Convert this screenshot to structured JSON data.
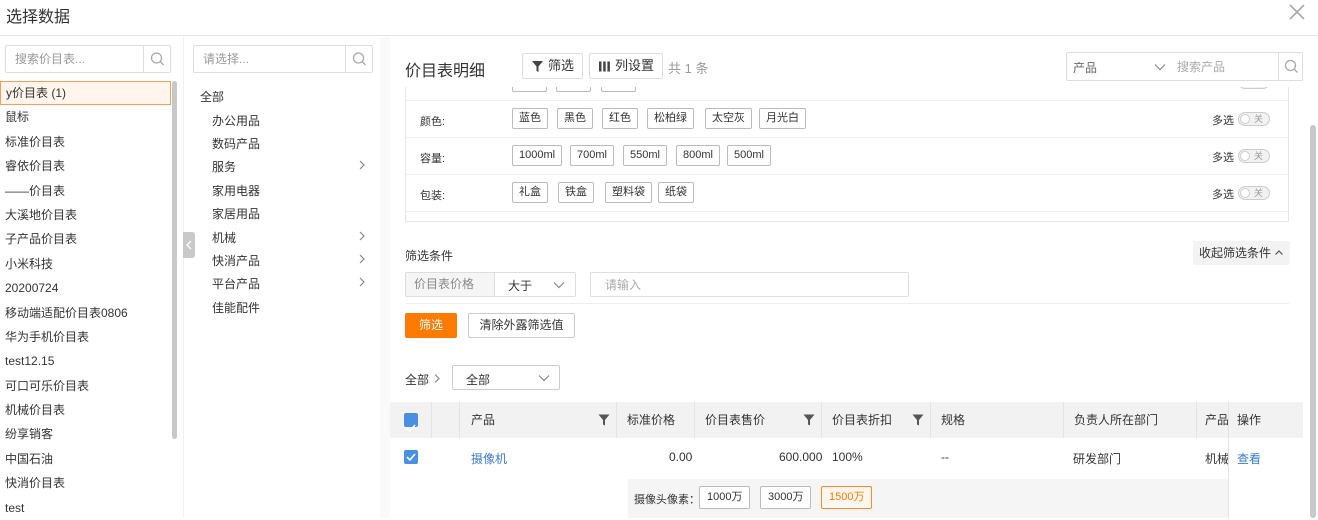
{
  "dialog": {
    "title": "选择数据"
  },
  "price_lists": {
    "search_placeholder": "搜索价目表...",
    "items": [
      "y价目表 (1)",
      "鼠标",
      "标准价目表",
      "睿依价目表",
      "——价目表",
      "大溪地价目表",
      "子产品价目表",
      "小米科技",
      "20200724",
      "移动端适配价目表0806",
      "华为手机价目表",
      "test12.15",
      "可口可乐价目表",
      "机械价目表",
      "纷享销客",
      "中国石油",
      "快消价目表",
      "test"
    ],
    "active_index": 0
  },
  "categories": {
    "search_placeholder": "请选择...",
    "all_label": "全部",
    "items": [
      {
        "label": "办公用品",
        "has_children": false
      },
      {
        "label": "数码产品",
        "has_children": false
      },
      {
        "label": "服务",
        "has_children": true
      },
      {
        "label": "家用电器",
        "has_children": false
      },
      {
        "label": "家居用品",
        "has_children": false
      },
      {
        "label": "机械",
        "has_children": true
      },
      {
        "label": "快消产品",
        "has_children": true
      },
      {
        "label": "平台产品",
        "has_children": true
      },
      {
        "label": "佳能配件",
        "has_children": false
      }
    ]
  },
  "main": {
    "title": "价目表明细",
    "filter_button": "筛选",
    "columns_button": "列设置",
    "count_text": "共 1 条",
    "product_select": "产品",
    "product_search_placeholder": "搜索产品"
  },
  "attributes": [
    {
      "label": "颜色:",
      "options": [
        "蓝色",
        "黑色",
        "红色",
        "松柏绿",
        "太空灰",
        "月光白"
      ],
      "multi_label": "多选",
      "toggle_label": "关"
    },
    {
      "label": "容量:",
      "options": [
        "1000ml",
        "700ml",
        "550ml",
        "800ml",
        "500ml"
      ],
      "multi_label": "多选",
      "toggle_label": "关"
    },
    {
      "label": "包装:",
      "options": [
        "礼盒",
        "铁盒",
        "塑料袋",
        "纸袋"
      ],
      "multi_label": "多选",
      "toggle_label": "关"
    }
  ],
  "filter": {
    "title": "筛选条件",
    "collapse_label": "收起筛选条件",
    "field": "价目表价格",
    "operator": "大于",
    "value_placeholder": "请输入",
    "apply_label": "筛选",
    "clear_label": "清除外露筛选值"
  },
  "breadcrumb": {
    "all": "全部",
    "select_value": "全部"
  },
  "table": {
    "headers": [
      "产品",
      "标准价格",
      "价目表售价",
      "价目表折扣",
      "规格",
      "负责人所在部门",
      "产品分类",
      "操作"
    ],
    "rows": [
      {
        "product": "摄像机",
        "standard_price": "0.00",
        "list_price": "600.000",
        "discount": "100%",
        "spec": "--",
        "department": "研发部门",
        "category": "机械/",
        "action": "查看"
      }
    ],
    "expand": {
      "label": "摄像头像素：",
      "options": [
        "1000万",
        "3000万",
        "1500万"
      ],
      "active_index": 2
    }
  }
}
